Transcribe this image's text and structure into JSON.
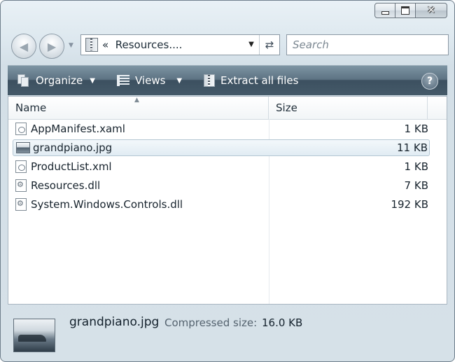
{
  "window": {
    "caption_buttons": [
      "minimize",
      "maximize",
      "close"
    ]
  },
  "navigation": {
    "back_icon": "back-arrow-icon",
    "forward_icon": "forward-arrow-icon",
    "recent_pages_icon": "chevron-down-icon"
  },
  "address_bar": {
    "prefix": "«",
    "location": "Resources....",
    "icon": "zip-folder-icon",
    "refresh_icon": "refresh-icon"
  },
  "search": {
    "placeholder": "Search",
    "value": ""
  },
  "toolbar": {
    "organize_label": "Organize",
    "views_label": "Views",
    "extract_label": "Extract all files",
    "help_label": "?"
  },
  "columns": {
    "name": "Name",
    "size": "Size"
  },
  "files": [
    {
      "name": "AppManifest.xaml",
      "size": "1 KB",
      "icon": "xaml-file-icon",
      "selected": false
    },
    {
      "name": "grandpiano.jpg",
      "size": "11 KB",
      "icon": "image-file-icon",
      "selected": true
    },
    {
      "name": "ProductList.xml",
      "size": "1 KB",
      "icon": "xml-file-icon",
      "selected": false
    },
    {
      "name": "Resources.dll",
      "size": "7 KB",
      "icon": "dll-file-icon",
      "selected": false
    },
    {
      "name": "System.Windows.Controls.dll",
      "size": "192 KB",
      "icon": "dll-file-icon",
      "selected": false
    }
  ],
  "details": {
    "file_name": "grandpiano.jpg",
    "compressed_label": "Compressed size:",
    "compressed_value": "16.0 KB"
  },
  "colors": {
    "toolbar": "#4a5f6e",
    "selection": "#e1ecf3",
    "frame": "#d6e1e8"
  }
}
